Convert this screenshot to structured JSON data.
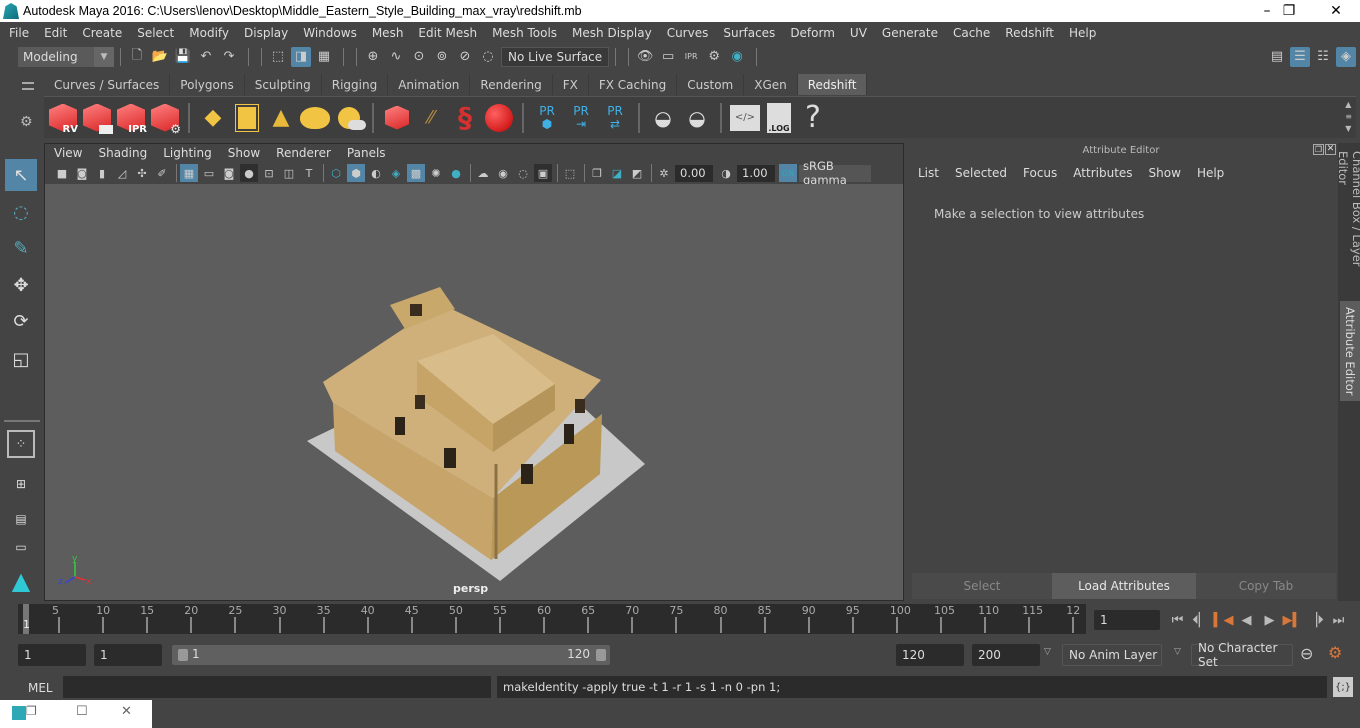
{
  "window": {
    "title": "Autodesk Maya 2016: C:\\Users\\lenov\\Desktop\\Middle_Eastern_Style_Building_max_vray\\redshift.mb",
    "controls": {
      "minimize": "–",
      "restore": "❐",
      "close": "✕"
    }
  },
  "menubar": [
    "File",
    "Edit",
    "Create",
    "Select",
    "Modify",
    "Display",
    "Windows",
    "Mesh",
    "Edit Mesh",
    "Mesh Tools",
    "Mesh Display",
    "Curves",
    "Surfaces",
    "Deform",
    "UV",
    "Generate",
    "Cache",
    "Redshift",
    "Help"
  ],
  "statusline": {
    "mode": "Modeling",
    "live_surface": "No Live Surface",
    "icons": [
      "new-scene",
      "open-scene",
      "save-scene",
      "undo",
      "redo",
      "select-by-hierarchy",
      "select-by-object",
      "select-by-component",
      "snap-grid",
      "snap-curve",
      "snap-point",
      "snap-view-plane",
      "snap-live",
      "render-view",
      "render-current",
      "ipr-render",
      "render-settings",
      "hypershade"
    ]
  },
  "shelf_tabs": {
    "items": [
      "Curves / Surfaces",
      "Polygons",
      "Sculpting",
      "Rigging",
      "Animation",
      "Rendering",
      "FX",
      "FX Caching",
      "Custom",
      "XGen",
      "Redshift"
    ],
    "active": "Redshift"
  },
  "shelf": {
    "redshift_render_buttons": [
      "RV",
      "",
      "IPR",
      ""
    ],
    "pr_labels": [
      "PR",
      "PR",
      "PR"
    ],
    "log_label": ".LOG",
    "help_label": "?"
  },
  "viewport": {
    "menu": [
      "View",
      "Shading",
      "Lighting",
      "Show",
      "Renderer",
      "Panels"
    ],
    "exposure": "0.00",
    "gamma": "1.00",
    "color_mgmt_toggle": "ON",
    "color_space": "sRGB gamma",
    "camera_label": "persp",
    "axis": {
      "x": "x",
      "y": "y",
      "z": "z"
    }
  },
  "attribute_editor": {
    "title": "Attribute Editor",
    "menu": [
      "List",
      "Selected",
      "Focus",
      "Attributes",
      "Show",
      "Help"
    ],
    "message": "Make a selection to view attributes",
    "buttons": [
      "Select",
      "Load Attributes",
      "Copy Tab"
    ]
  },
  "side_tabs": [
    "Channel Box / Layer Editor",
    "Attribute Editor"
  ],
  "timeline": {
    "current_frame": "1",
    "labels": [
      "5",
      "10",
      "15",
      "20",
      "25",
      "30",
      "35",
      "40",
      "45",
      "50",
      "55",
      "60",
      "65",
      "70",
      "75",
      "80",
      "85",
      "90",
      "95",
      "100",
      "105",
      "110",
      "115",
      "12"
    ],
    "frame_field": "1"
  },
  "range": {
    "start": "1",
    "playback_start": "1",
    "slider_min": "1",
    "slider_max": "120",
    "playback_end": "120",
    "end": "200",
    "anim_layer": "No Anim Layer",
    "character_set": "No Character Set"
  },
  "command": {
    "language": "MEL",
    "input": "",
    "result": "makeIdentity -apply true -t 1 -r 1 -s 1 -n 0 -pn 1;"
  },
  "colors": {
    "accent": "#5285a6",
    "redshift_red": "#e03030",
    "yellow_icon": "#f2c443",
    "pr_blue": "#3fb0e6",
    "teal": "#2fa8b5",
    "orange_key": "#d9773a"
  }
}
